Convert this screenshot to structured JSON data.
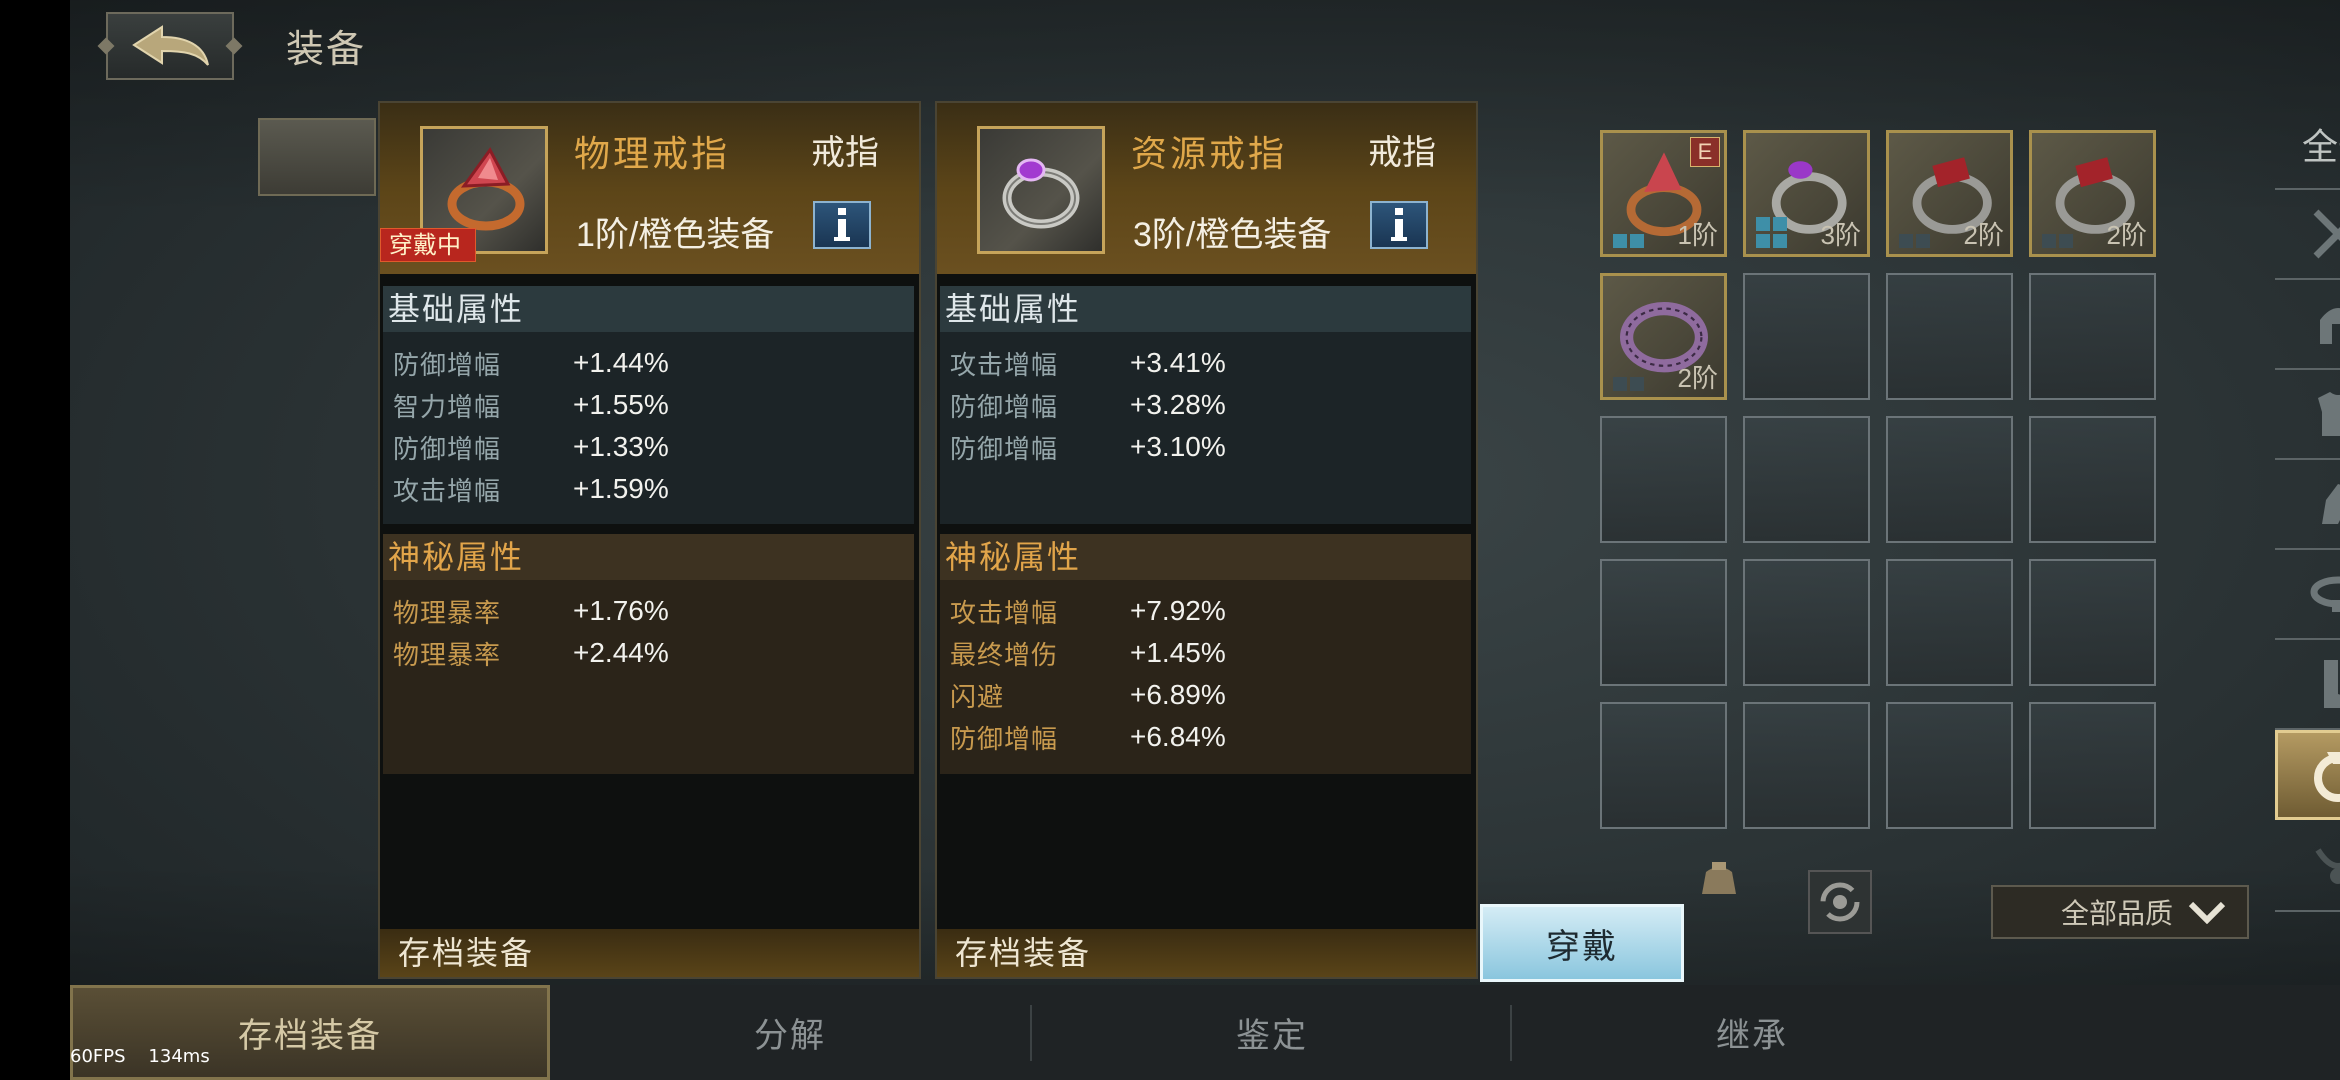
{
  "header": {
    "title": "装备"
  },
  "cards": [
    {
      "name": "物理戒指",
      "type": "戒指",
      "tier": "1阶/橙色装备",
      "equipped_tag": "穿戴中",
      "basic_title": "基础属性",
      "basic": [
        {
          "label": "防御增幅",
          "value": "+1.44%"
        },
        {
          "label": "智力增幅",
          "value": "+1.55%"
        },
        {
          "label": "防御增幅",
          "value": "+1.33%"
        },
        {
          "label": "攻击增幅",
          "value": "+1.59%"
        }
      ],
      "myst_title": "神秘属性",
      "myst": [
        {
          "label": "物理暴率",
          "value": "+1.76%"
        },
        {
          "label": "物理暴率",
          "value": "+2.44%"
        }
      ],
      "footer": "存档装备"
    },
    {
      "name": "资源戒指",
      "type": "戒指",
      "tier": "3阶/橙色装备",
      "basic_title": "基础属性",
      "basic": [
        {
          "label": "攻击增幅",
          "value": "+3.41%"
        },
        {
          "label": "防御增幅",
          "value": "+3.28%"
        },
        {
          "label": "防御增幅",
          "value": "+3.10%"
        }
      ],
      "myst_title": "神秘属性",
      "myst": [
        {
          "label": "攻击增幅",
          "value": "+7.92%"
        },
        {
          "label": "最终增伤",
          "value": "+1.45%"
        },
        {
          "label": "闪避",
          "value": "+6.89%"
        },
        {
          "label": "防御增幅",
          "value": "+6.84%"
        }
      ],
      "footer": "存档装备"
    }
  ],
  "equip_button": "穿戴",
  "inventory": [
    {
      "tier": "1阶",
      "badge": "E",
      "icon": "orange-ring-icon"
    },
    {
      "tier": "3阶",
      "icon": "purple-ring-icon"
    },
    {
      "tier": "2阶",
      "icon": "red-gem-ring-icon"
    },
    {
      "tier": "2阶",
      "icon": "red-gem-ring-icon"
    },
    {
      "tier": "2阶",
      "icon": "purple-band-ring-icon"
    }
  ],
  "categories": {
    "all": "全部"
  },
  "quality_filter": "全部品质",
  "bottom_tabs": [
    "存档装备",
    "分解",
    "鉴定",
    "继承"
  ],
  "fps": "60FPS    134ms"
}
